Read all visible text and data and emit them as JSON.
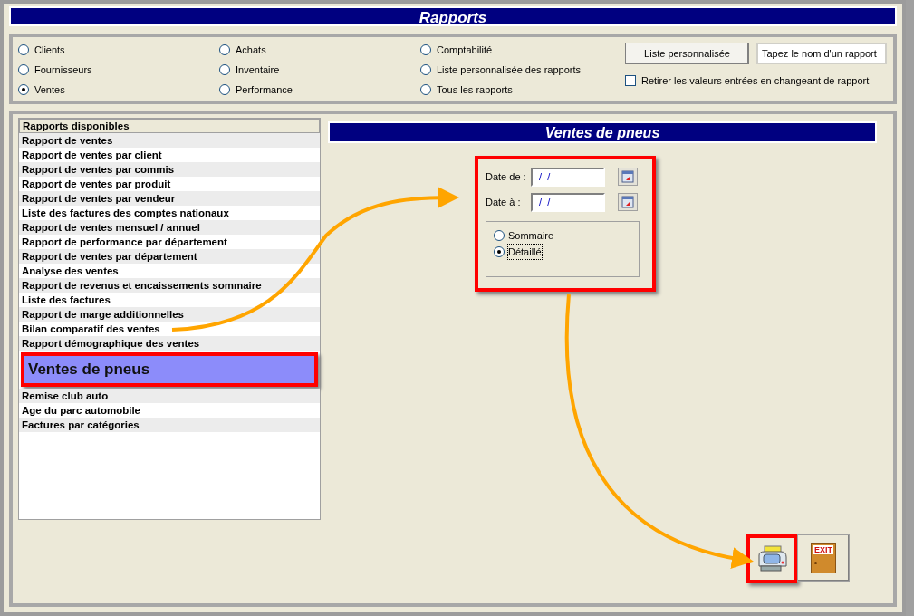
{
  "window": {
    "title": "Rapports"
  },
  "report_types": [
    {
      "label": "Clients",
      "selected": false
    },
    {
      "label": "Fournisseurs",
      "selected": false
    },
    {
      "label": "Ventes",
      "selected": true
    },
    {
      "label": "Achats",
      "selected": false
    },
    {
      "label": "Inventaire",
      "selected": false
    },
    {
      "label": "Performance",
      "selected": false
    },
    {
      "label": "Comptabilité",
      "selected": false
    },
    {
      "label": "Liste personnalisée des rapports",
      "selected": false
    },
    {
      "label": "Tous les rapports",
      "selected": false
    }
  ],
  "custom_list_button": "Liste personnalisée",
  "report_name_field": {
    "value": "Tapez le nom d'un rapport"
  },
  "clear_values_checkbox": {
    "label": "Retirer les valeurs entrées en changeant de rapport",
    "checked": false
  },
  "report_list": {
    "header": "Rapports disponibles",
    "items": [
      {
        "label": "Rapport de ventes",
        "selected": false
      },
      {
        "label": "Rapport de ventes par client",
        "selected": false
      },
      {
        "label": "Rapport de ventes par commis",
        "selected": false
      },
      {
        "label": "Rapport de ventes par produit",
        "selected": false
      },
      {
        "label": "Rapport de ventes par vendeur",
        "selected": false
      },
      {
        "label": "Liste des factures des comptes nationaux",
        "selected": false
      },
      {
        "label": "Rapport de ventes mensuel / annuel",
        "selected": false
      },
      {
        "label": "Rapport de performance par département",
        "selected": false
      },
      {
        "label": "Rapport de ventes par département",
        "selected": false
      },
      {
        "label": "Analyse des ventes",
        "selected": false
      },
      {
        "label": "Rapport de revenus et encaissements sommaire",
        "selected": false
      },
      {
        "label": "Liste des factures",
        "selected": false
      },
      {
        "label": "Rapport de marge additionnelles",
        "selected": false
      },
      {
        "label": "Bilan comparatif des ventes",
        "selected": false
      },
      {
        "label": "Rapport démographique des ventes",
        "selected": false
      },
      {
        "label": "Ventes de pneus",
        "selected": true
      },
      {
        "label": "Remise club auto",
        "selected": false
      },
      {
        "label": "Age du parc automobile",
        "selected": false
      },
      {
        "label": "Factures par catégories",
        "selected": false
      }
    ]
  },
  "report_panel": {
    "title": "Ventes de pneus",
    "dates": [
      {
        "label": "Date de :",
        "value": " /  /"
      },
      {
        "label": "Date à :",
        "value": " /  /"
      }
    ],
    "detail_options": [
      {
        "label": "Sommaire",
        "selected": false
      },
      {
        "label": "Détaillé",
        "selected": true
      }
    ]
  },
  "exit_label": "EXIT"
}
